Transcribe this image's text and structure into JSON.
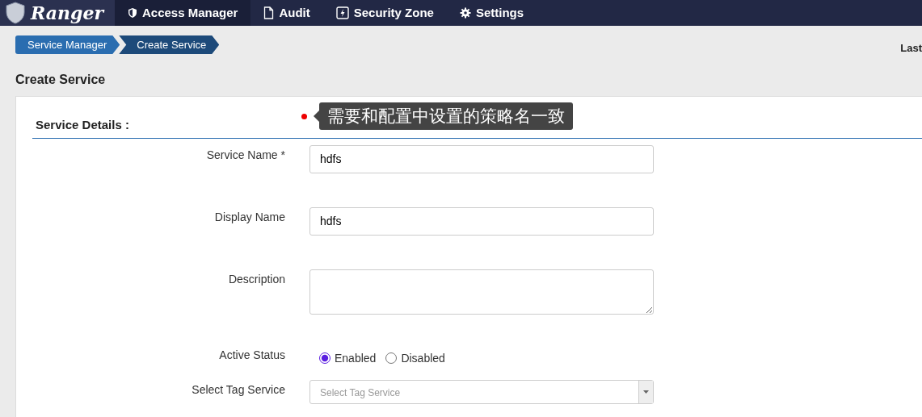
{
  "navbar": {
    "brand": "Ranger",
    "items": [
      {
        "label": "Access Manager",
        "selected": true
      },
      {
        "label": "Audit",
        "selected": false
      },
      {
        "label": "Security Zone",
        "selected": false
      },
      {
        "label": "Settings",
        "selected": false
      }
    ]
  },
  "breadcrumb": [
    "Service Manager",
    "Create Service"
  ],
  "last_updated_label": "Last",
  "page_title": "Create Service",
  "annotation": "需要和配置中设置的策略名一致",
  "section_title": "Service Details :",
  "fields": [
    {
      "kind": "input",
      "label": "Service Name *",
      "value": "hdfs"
    },
    {
      "kind": "input",
      "label": "Display Name",
      "value": "hdfs"
    },
    {
      "kind": "textarea",
      "label": "Description"
    },
    {
      "kind": "radio",
      "label": "Active Status",
      "options": [
        {
          "label": "Enabled",
          "selected": true
        },
        {
          "label": "Disabled",
          "selected": false
        }
      ]
    },
    {
      "kind": "select",
      "label": "Select Tag Service",
      "placeholder": "Select Tag Service"
    }
  ]
}
